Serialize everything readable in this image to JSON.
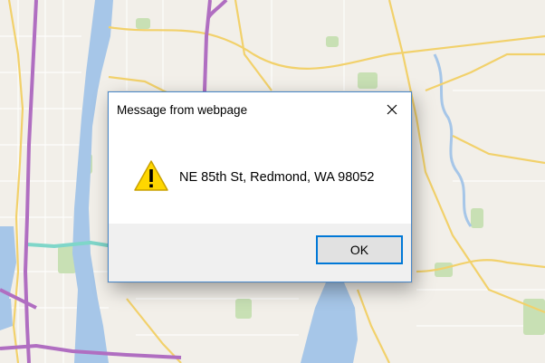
{
  "dialog": {
    "title": "Message from webpage",
    "message": "NE 85th St, Redmond, WA 98052",
    "ok_label": "OK",
    "close_icon": "close-icon",
    "warning_icon": "warning-icon"
  },
  "colors": {
    "map_land": "#f2efe9",
    "map_water": "#a6c6e8",
    "map_park": "#c8e0b4",
    "highway": "#b06ec1",
    "arterial": "#f2d16b",
    "dialog_border": "#4a88c9",
    "button_focus": "#0078d7",
    "warning_yellow": "#ffd700"
  }
}
